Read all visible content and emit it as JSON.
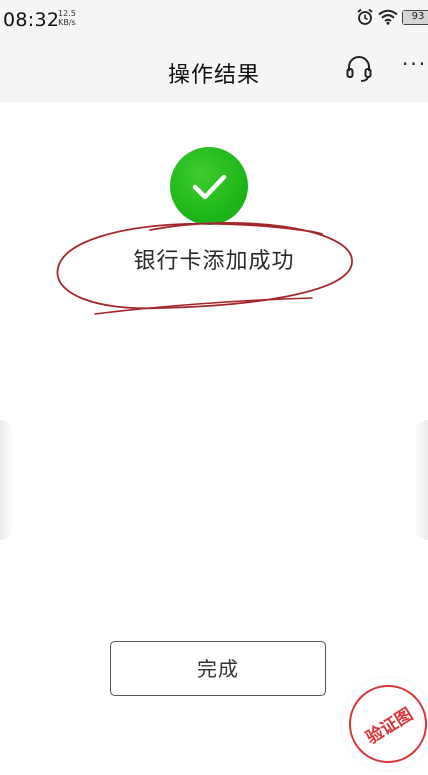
{
  "status_bar": {
    "time": "08:32",
    "net_speed_value": "12.5",
    "net_speed_unit": "KB/s",
    "battery_level": "93",
    "icons": [
      "alarm-icon",
      "wifi-icon",
      "battery-icon"
    ]
  },
  "header": {
    "title": "操作结果",
    "actions": [
      "headset-icon",
      "more-icon"
    ],
    "more_label": "···"
  },
  "result": {
    "icon": "check-circle-icon",
    "message": "银行卡添加成功",
    "icon_color": "#1fb71a"
  },
  "footer": {
    "done_label": "完成"
  },
  "stamp": {
    "text": "验证图",
    "color": "#d6353a"
  }
}
